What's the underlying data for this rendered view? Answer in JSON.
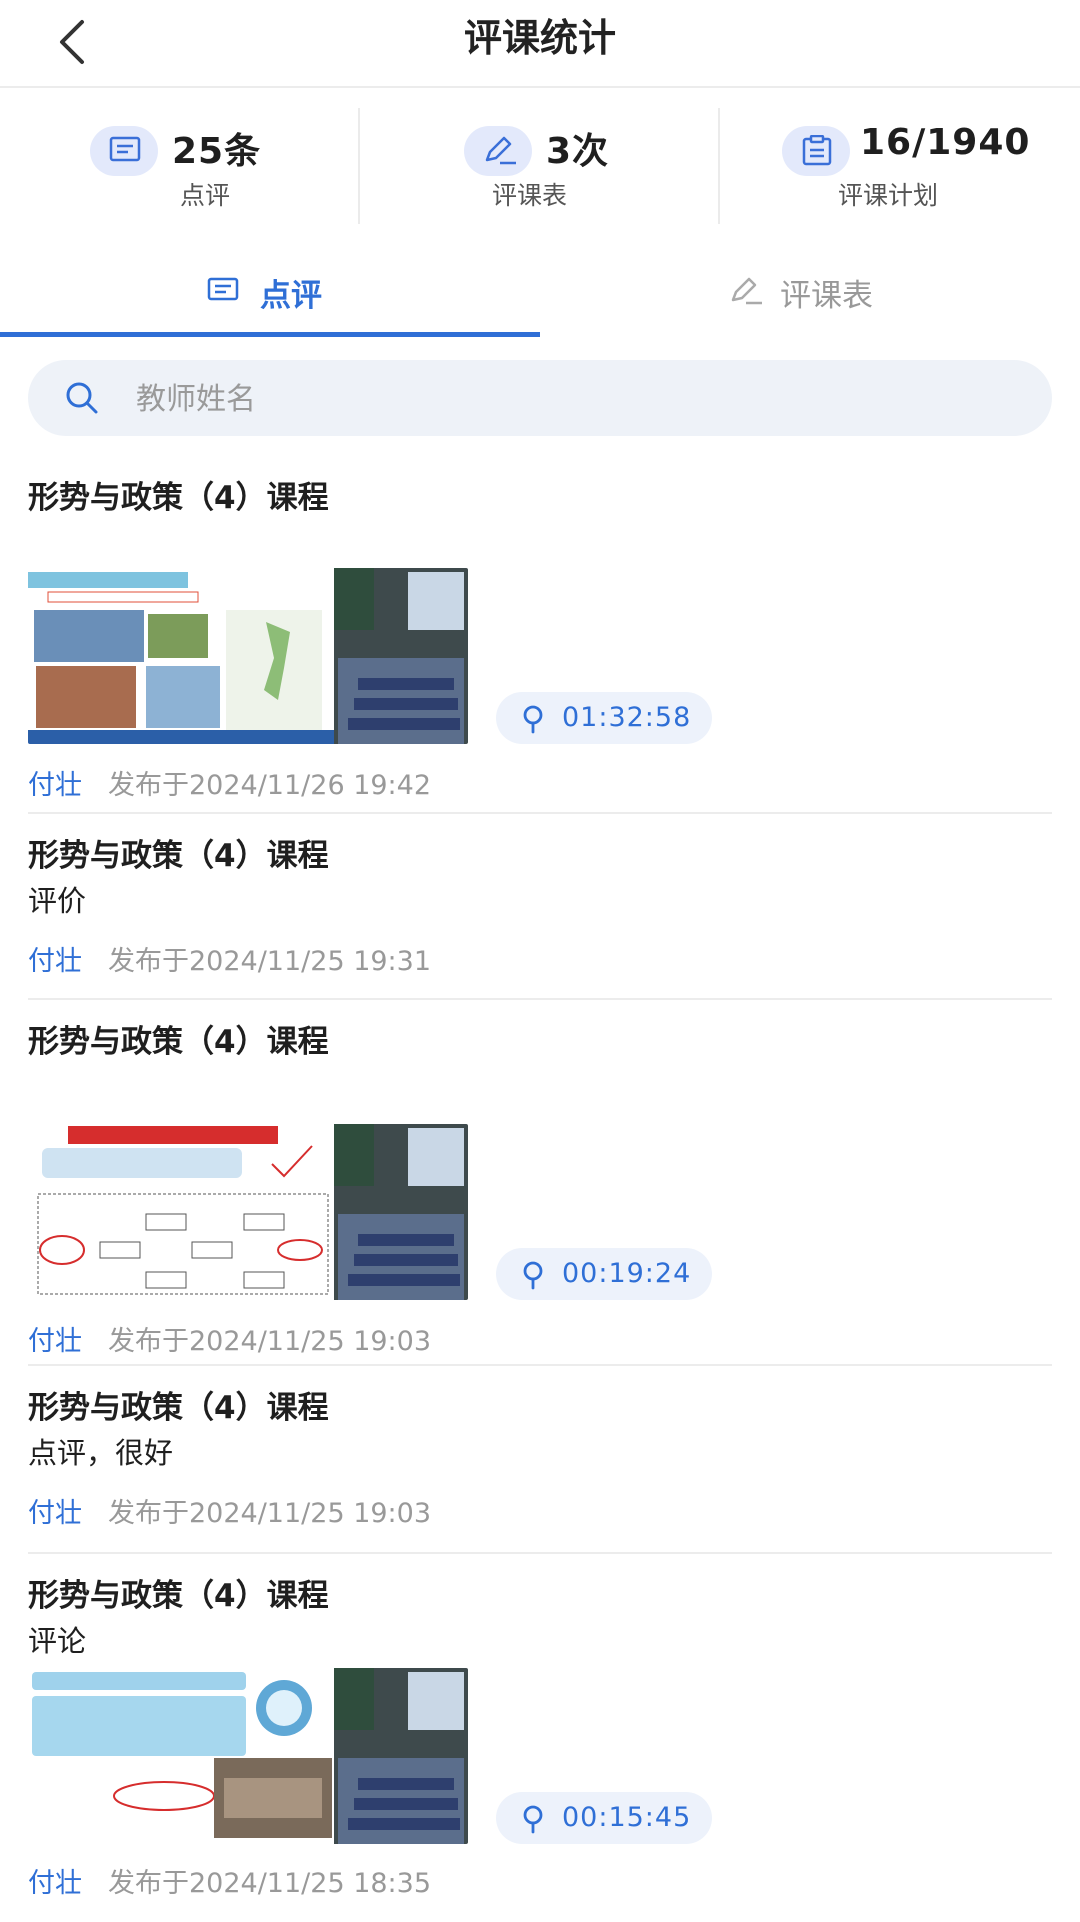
{
  "header": {
    "title": "评课统计",
    "back_icon": "chevron-left-icon"
  },
  "stats": [
    {
      "value": "25条",
      "label": "点评",
      "icon": "comment-icon"
    },
    {
      "value": "3次",
      "label": "评课表",
      "icon": "edit-icon"
    },
    {
      "value": "16/1940",
      "label": "评课计划",
      "icon": "plan-icon"
    }
  ],
  "tabs": [
    {
      "label": "点评",
      "icon": "comment-icon",
      "active": true
    },
    {
      "label": "评课表",
      "icon": "edit-icon",
      "active": false
    }
  ],
  "search": {
    "placeholder": "教师姓名",
    "value": ""
  },
  "items": [
    {
      "course": "形势与政策（4）课程",
      "comment": "",
      "duration": "01:32:58",
      "author": "付壮",
      "published": "发布于2024/11/26 19:42",
      "has_video": true
    },
    {
      "course": "形势与政策（4）课程",
      "comment": "评价",
      "duration": "",
      "author": "付壮",
      "published": "发布于2024/11/25 19:31",
      "has_video": false
    },
    {
      "course": "形势与政策（4）课程",
      "comment": "",
      "duration": "00:19:24",
      "author": "付壮",
      "published": "发布于2024/11/25 19:03",
      "has_video": true
    },
    {
      "course": "形势与政策（4）课程",
      "comment": "点评，很好",
      "duration": "",
      "author": "付壮",
      "published": "发布于2024/11/25 19:03",
      "has_video": false
    },
    {
      "course": "形势与政策（4）课程",
      "comment": "评论",
      "duration": "00:15:45",
      "author": "付壮",
      "published": "发布于2024/11/25 18:35",
      "has_video": true
    }
  ],
  "colors": {
    "accent": "#2f6fd6",
    "badge_bg": "#edf2fb",
    "icon_bg": "#e3e9fb"
  }
}
